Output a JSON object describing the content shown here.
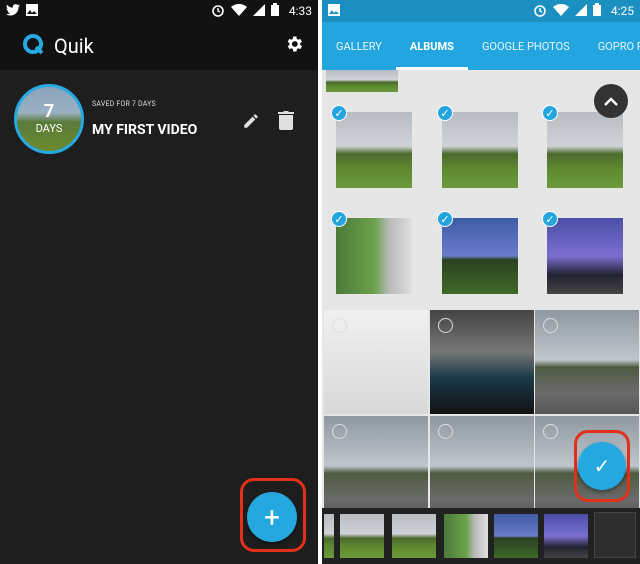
{
  "left": {
    "status": {
      "time": "4:33"
    },
    "app_title": "Quik",
    "video": {
      "days_number": "7",
      "days_label": "DAYS",
      "saved_text": "SAVED FOR 7 DAYS",
      "name": "MY FIRST VIDEO"
    },
    "fab_label": "+"
  },
  "right": {
    "status": {
      "time": "4:25"
    },
    "tabs": [
      {
        "label": "GALLERY"
      },
      {
        "label": "ALBUMS"
      },
      {
        "label": "GOOGLE PHOTOS"
      },
      {
        "label": "GOPRO PL"
      }
    ],
    "confirm_label": "✓"
  },
  "colors": {
    "accent": "#23A6DF",
    "dark_bg": "#1E1E1E",
    "highlight": "#E3301B"
  }
}
